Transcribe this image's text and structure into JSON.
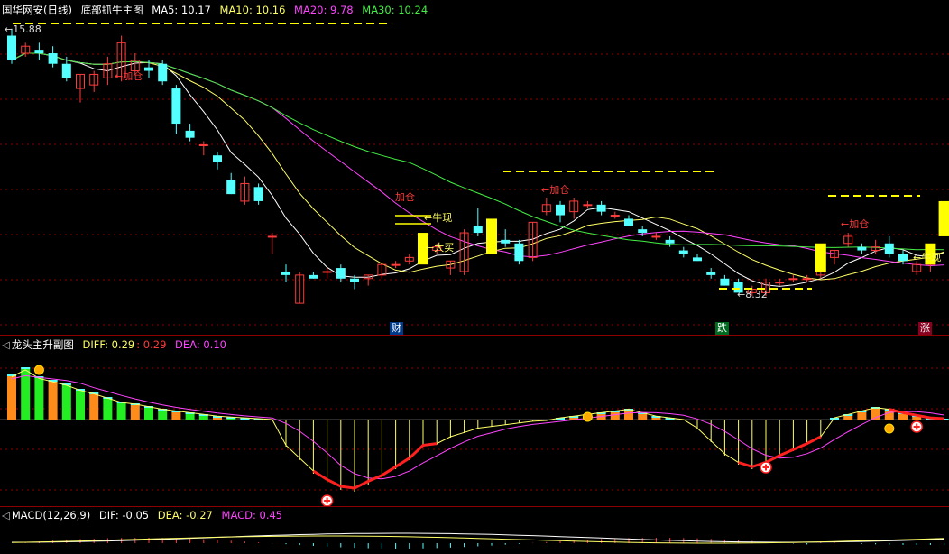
{
  "main_panel": {
    "stock_name": "国华网安",
    "period": "(日线)",
    "indicator": "底部抓牛主图",
    "ma5": {
      "label": "MA5: 10.17",
      "color": "#ffffff"
    },
    "ma10": {
      "label": "MA10: 10.16",
      "color": "#ffff66"
    },
    "ma20": {
      "label": "MA20: 9.78",
      "color": "#ff44ff"
    },
    "ma30": {
      "label": "MA30: 10.24",
      "color": "#44ee44"
    },
    "high_marker": "←15.88",
    "low_marker": "←8.32",
    "signals": {
      "jiacang": "加仓",
      "niuxian": "←牛现",
      "damai": "←大买"
    },
    "events": {
      "cai": "财",
      "die": "跌",
      "zhang": "涨"
    }
  },
  "sub_panel": {
    "title": "龙头主升副图",
    "diff": "DIFF: 0.29",
    "diff2": ": 0.29",
    "dea": "DEA: 0.10"
  },
  "macd_panel": {
    "title": "MACD(12,26,9)",
    "dif": "DIF: -0.05",
    "dea": "DEA: -0.27",
    "macd": "MACD: 0.45"
  },
  "colors": {
    "up": "#ff3b3b",
    "down": "#54ffff",
    "signal_bar": "#ffff00",
    "grid": "#8b0000"
  },
  "chart_data": {
    "type": "candlestick",
    "candles": [
      {
        "o": 15.7,
        "h": 15.9,
        "l": 14.9,
        "c": 15.0
      },
      {
        "o": 15.2,
        "h": 15.5,
        "l": 15.1,
        "c": 15.4
      },
      {
        "o": 15.3,
        "h": 15.5,
        "l": 15.0,
        "c": 15.2
      },
      {
        "o": 15.2,
        "h": 15.4,
        "l": 14.8,
        "c": 14.9
      },
      {
        "o": 14.9,
        "h": 15.1,
        "l": 14.4,
        "c": 14.5
      },
      {
        "o": 14.2,
        "h": 14.6,
        "l": 13.8,
        "c": 14.6
      },
      {
        "o": 14.3,
        "h": 14.7,
        "l": 14.1,
        "c": 14.6
      },
      {
        "o": 14.5,
        "h": 15.1,
        "l": 14.3,
        "c": 14.9
      },
      {
        "o": 14.5,
        "h": 15.7,
        "l": 14.4,
        "c": 15.5
      },
      {
        "o": 14.7,
        "h": 15.2,
        "l": 14.6,
        "c": 15.0
      },
      {
        "o": 14.8,
        "h": 15.0,
        "l": 14.5,
        "c": 14.7
      },
      {
        "o": 14.9,
        "h": 15.0,
        "l": 14.3,
        "c": 14.4
      },
      {
        "o": 14.2,
        "h": 14.3,
        "l": 12.9,
        "c": 13.2
      },
      {
        "o": 13.0,
        "h": 13.2,
        "l": 12.7,
        "c": 12.8
      },
      {
        "o": 12.6,
        "h": 12.7,
        "l": 12.3,
        "c": 12.6
      },
      {
        "o": 12.3,
        "h": 12.4,
        "l": 11.9,
        "c": 12.1
      },
      {
        "o": 11.6,
        "h": 11.8,
        "l": 11.2,
        "c": 11.2
      },
      {
        "o": 11.0,
        "h": 11.7,
        "l": 10.9,
        "c": 11.5
      },
      {
        "o": 11.4,
        "h": 11.5,
        "l": 10.9,
        "c": 11.0
      },
      {
        "o": 10.0,
        "h": 10.1,
        "l": 9.5,
        "c": 10.0
      },
      {
        "o": 9.0,
        "h": 9.2,
        "l": 8.7,
        "c": 8.9
      },
      {
        "o": 8.1,
        "h": 9.0,
        "l": 8.1,
        "c": 8.9
      },
      {
        "o": 8.9,
        "h": 9.0,
        "l": 8.8,
        "c": 8.8
      },
      {
        "o": 9.0,
        "h": 9.1,
        "l": 8.8,
        "c": 9.0
      },
      {
        "o": 9.1,
        "h": 9.2,
        "l": 8.7,
        "c": 8.8
      },
      {
        "o": 8.8,
        "h": 8.9,
        "l": 8.5,
        "c": 8.7
      },
      {
        "o": 8.8,
        "h": 8.9,
        "l": 8.6,
        "c": 8.9
      },
      {
        "o": 8.9,
        "h": 9.2,
        "l": 8.8,
        "c": 9.2
      },
      {
        "o": 9.2,
        "h": 9.3,
        "l": 9.1,
        "c": 9.2
      },
      {
        "o": 9.3,
        "h": 9.5,
        "l": 9.2,
        "c": 9.4
      },
      {
        "o": 9.4,
        "h": 9.9,
        "l": 9.3,
        "c": 9.8
      },
      {
        "o": 9.6,
        "h": 9.8,
        "l": 9.5,
        "c": 9.7
      },
      {
        "o": 9.1,
        "h": 9.3,
        "l": 8.9,
        "c": 9.3
      },
      {
        "o": 9.0,
        "h": 10.2,
        "l": 8.9,
        "c": 10.1
      },
      {
        "o": 10.3,
        "h": 10.8,
        "l": 10.0,
        "c": 10.1
      },
      {
        "o": 10.1,
        "h": 10.5,
        "l": 9.9,
        "c": 10.0
      },
      {
        "o": 9.9,
        "h": 10.2,
        "l": 9.7,
        "c": 9.8
      },
      {
        "o": 9.8,
        "h": 9.9,
        "l": 9.2,
        "c": 9.3
      },
      {
        "o": 9.4,
        "h": 10.4,
        "l": 9.3,
        "c": 10.4
      },
      {
        "o": 10.7,
        "h": 11.1,
        "l": 10.6,
        "c": 10.9
      },
      {
        "o": 10.9,
        "h": 11.0,
        "l": 10.4,
        "c": 10.6
      },
      {
        "o": 10.7,
        "h": 11.1,
        "l": 10.5,
        "c": 11.0
      },
      {
        "o": 10.9,
        "h": 11.0,
        "l": 10.8,
        "c": 10.9
      },
      {
        "o": 10.9,
        "h": 11.0,
        "l": 10.6,
        "c": 10.7
      },
      {
        "o": 10.6,
        "h": 10.7,
        "l": 10.5,
        "c": 10.6
      },
      {
        "o": 10.5,
        "h": 10.6,
        "l": 10.3,
        "c": 10.3
      },
      {
        "o": 10.2,
        "h": 10.3,
        "l": 10.0,
        "c": 10.1
      },
      {
        "o": 10.0,
        "h": 10.1,
        "l": 9.9,
        "c": 10.0
      },
      {
        "o": 9.9,
        "h": 10.0,
        "l": 9.7,
        "c": 9.8
      },
      {
        "o": 9.6,
        "h": 9.7,
        "l": 9.4,
        "c": 9.5
      },
      {
        "o": 9.4,
        "h": 9.5,
        "l": 9.3,
        "c": 9.3
      },
      {
        "o": 9.0,
        "h": 9.1,
        "l": 8.8,
        "c": 8.9
      },
      {
        "o": 8.8,
        "h": 8.9,
        "l": 8.6,
        "c": 8.6
      },
      {
        "o": 8.7,
        "h": 8.8,
        "l": 8.4,
        "c": 8.4
      },
      {
        "o": 8.4,
        "h": 8.6,
        "l": 8.3,
        "c": 8.5
      },
      {
        "o": 8.4,
        "h": 8.8,
        "l": 8.3,
        "c": 8.7
      },
      {
        "o": 8.7,
        "h": 8.8,
        "l": 8.6,
        "c": 8.7
      },
      {
        "o": 8.8,
        "h": 8.9,
        "l": 8.7,
        "c": 8.8
      },
      {
        "o": 8.8,
        "h": 8.9,
        "l": 8.7,
        "c": 8.8
      },
      {
        "o": 8.9,
        "h": 9.0,
        "l": 8.8,
        "c": 9.0
      },
      {
        "o": 9.4,
        "h": 9.6,
        "l": 9.2,
        "c": 9.6
      },
      {
        "o": 9.8,
        "h": 10.1,
        "l": 9.7,
        "c": 10.0
      },
      {
        "o": 9.7,
        "h": 9.8,
        "l": 9.5,
        "c": 9.6
      },
      {
        "o": 9.6,
        "h": 9.9,
        "l": 9.5,
        "c": 9.7
      },
      {
        "o": 9.8,
        "h": 10.0,
        "l": 9.4,
        "c": 9.5
      },
      {
        "o": 9.5,
        "h": 9.6,
        "l": 9.2,
        "c": 9.3
      },
      {
        "o": 9.0,
        "h": 9.3,
        "l": 8.9,
        "c": 9.2
      },
      {
        "o": 9.2,
        "h": 9.5,
        "l": 9.0,
        "c": 9.4
      },
      {
        "o": 10.2,
        "h": 10.4,
        "l": 10.0,
        "c": 10.3
      }
    ],
    "ylim": [
      8.0,
      16.2
    ]
  }
}
